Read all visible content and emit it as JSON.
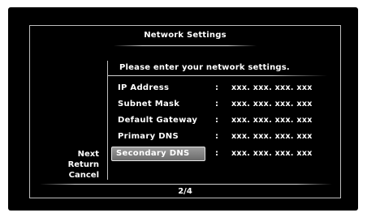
{
  "header": {
    "title": "Network Settings"
  },
  "prompt": "Please enter your network settings.",
  "fields": [
    {
      "label": "IP Address",
      "separator": ":",
      "value": "xxx. xxx. xxx. xxx"
    },
    {
      "label": "Subnet Mask",
      "separator": ":",
      "value": "xxx. xxx. xxx. xxx"
    },
    {
      "label": "Default Gateway",
      "separator": ":",
      "value": "xxx. xxx. xxx. xxx"
    },
    {
      "label": "Primary DNS",
      "separator": ":",
      "value": "xxx. xxx. xxx. xxx"
    },
    {
      "label": "Secondary DNS",
      "separator": ":",
      "value": "xxx. xxx. xxx. xxx",
      "selected": true
    }
  ],
  "side_menu": {
    "next": "Next",
    "return": "Return",
    "cancel": "Cancel"
  },
  "footer": {
    "page": "2/4"
  }
}
